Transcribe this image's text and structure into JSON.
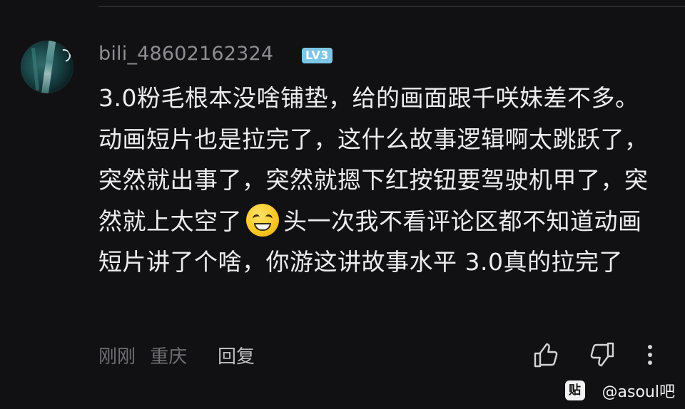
{
  "comment": {
    "username": "bili_48602162324",
    "level_badge": "LV3",
    "text_before_emoji": "3.0粉毛根本没啥铺垫，给的画面跟千咲妹差不多。动画短片也是拉完了，这什么故事逻辑啊太跳跃了，突然就出事了，突然就摁下红按钮要驾驶机甲了，突然就上太空了",
    "emoji_icon": "grinning-squint-emoji",
    "text_after_emoji": "头一次我不看评论区都不知道动画短片讲了个啥，你游这讲故事水平 3.0真的拉完了",
    "time": "刚刚",
    "location": "重庆",
    "reply_label": "回复"
  },
  "watermark": {
    "logo_text": "贴",
    "text": "@asoul吧"
  },
  "colors": {
    "background": "#111113",
    "username": "#8d8d93",
    "level_badge": "#7dc6e6",
    "text": "#ececee",
    "meta": "#6e6e74"
  }
}
